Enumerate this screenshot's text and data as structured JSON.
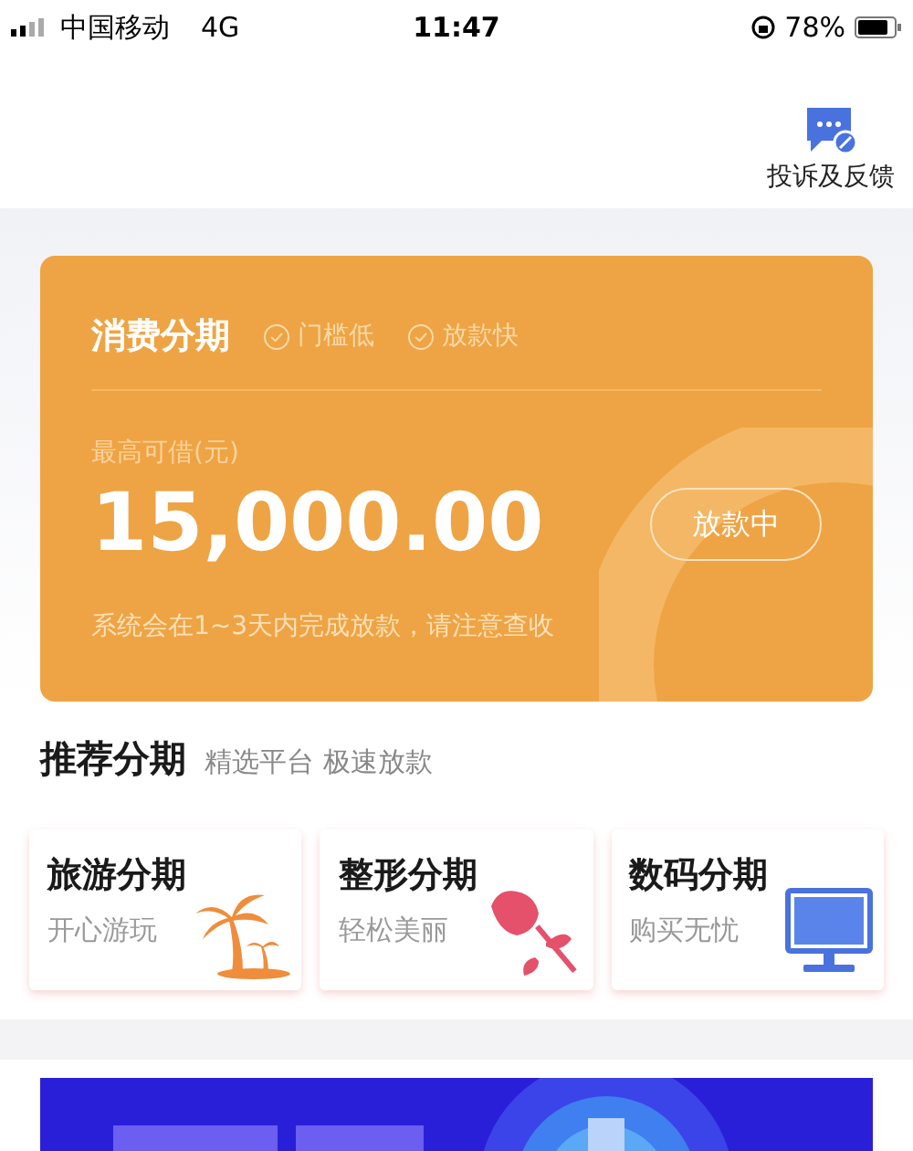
{
  "status_bar": {
    "carrier": "中国移动",
    "network": "4G",
    "time": "11:47",
    "battery": "78%"
  },
  "header": {
    "feedback_label": "投诉及反馈"
  },
  "loan_card": {
    "title": "消费分期",
    "tags": [
      "门槛低",
      "放款快"
    ],
    "amount_label": "最高可借(元)",
    "amount": "15,000.00",
    "status_button": "放款中",
    "note": "系统会在1~3天内完成放款，请注意查收"
  },
  "recommend": {
    "title": "推荐分期",
    "subtitle": "精选平台 极速放款",
    "items": [
      {
        "kind": "travel",
        "title": "旅游分期",
        "subtitle": "开心游玩"
      },
      {
        "kind": "beauty",
        "title": "整形分期",
        "subtitle": "轻松美丽"
      },
      {
        "kind": "digital",
        "title": "数码分期",
        "subtitle": "购买无忧"
      }
    ]
  }
}
